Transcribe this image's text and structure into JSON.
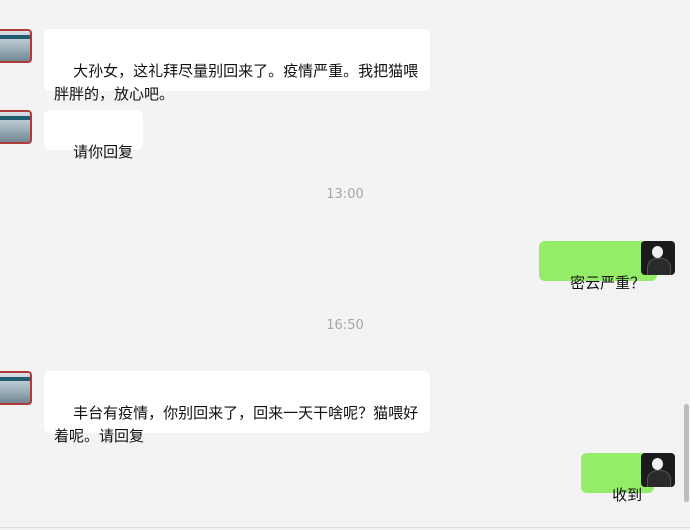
{
  "messages": [
    {
      "side": "left",
      "text": "大孙女，这礼拜尽量别回来了。疫情严重。我把猫喂胖胖的，放心吧。"
    },
    {
      "side": "left",
      "text": "请你回复"
    },
    {
      "type": "time",
      "text": "13:00"
    },
    {
      "side": "right",
      "text": "密云严重？"
    },
    {
      "type": "time",
      "text": "16:50"
    },
    {
      "side": "left",
      "text": "丰台有疫情，你别回来了，回来一天干啥呢？猫喂好着呢。请回复"
    },
    {
      "side": "right",
      "text": "收到"
    }
  ],
  "colors": {
    "background": "#f3f3f3",
    "incoming_bubble": "#ffffff",
    "outgoing_bubble": "#95ec69",
    "timestamp": "#a6a6a6"
  }
}
